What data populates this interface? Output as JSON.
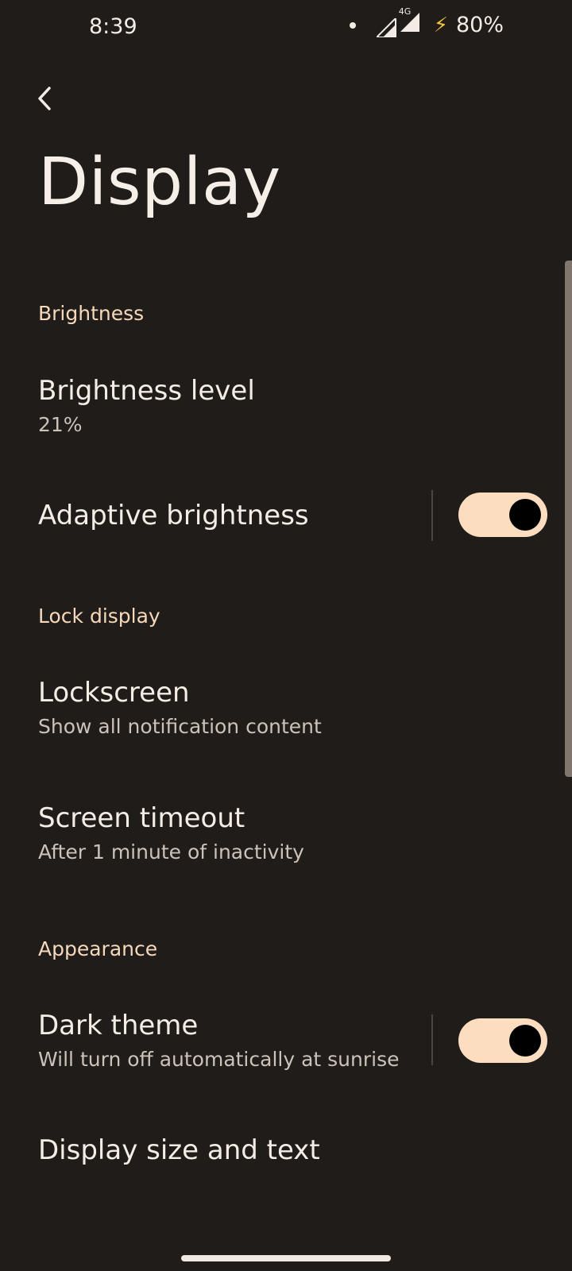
{
  "status_bar": {
    "time": "8:39",
    "network": "4G",
    "battery": "80%"
  },
  "title": "Display",
  "sections": {
    "brightness": {
      "header": "Brightness",
      "brightness_level": {
        "title": "Brightness level",
        "value": "21%"
      },
      "adaptive_brightness": {
        "title": "Adaptive brightness",
        "enabled": true
      }
    },
    "lock_display": {
      "header": "Lock display",
      "lockscreen": {
        "title": "Lockscreen",
        "subtitle": "Show all notification content"
      },
      "screen_timeout": {
        "title": "Screen timeout",
        "subtitle": "After 1 minute of inactivity"
      }
    },
    "appearance": {
      "header": "Appearance",
      "dark_theme": {
        "title": "Dark theme",
        "subtitle": "Will turn off automatically at sunrise",
        "enabled": true
      },
      "display_size": {
        "title": "Display size and text"
      }
    }
  },
  "colors": {
    "background": "#201c19",
    "accent": "#f6d8bb",
    "toggle_track": "#fdddc0"
  }
}
